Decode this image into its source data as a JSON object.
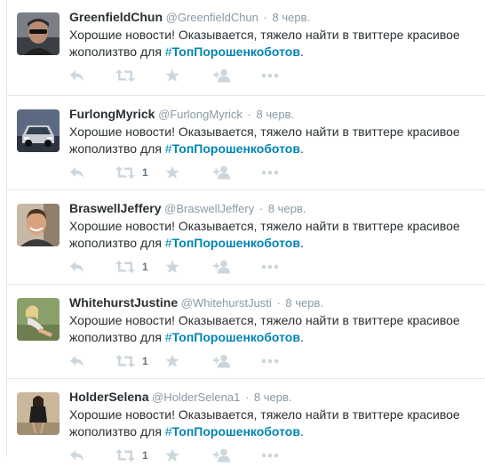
{
  "tweets": [
    {
      "fullname": "GreenfieldChun",
      "handle": "@GreenfieldChun",
      "separator": "·",
      "time": "8 черв.",
      "text_line1": "Хорошие новости! Оказывается, тяжело найти в твиттере красивое",
      "text_prefix": "жополизтво для ",
      "hash_symbol": "#",
      "hashtag": "ТопПорошенкоботов",
      "text_suffix": ".",
      "retweet_count": "",
      "avatar_icon": "man-with-sunglasses-avatar"
    },
    {
      "fullname": "FurlongMyrick",
      "handle": "@FurlongMyrick",
      "separator": "·",
      "time": "8 черв.",
      "text_line1": "Хорошие новости! Оказывается, тяжело найти в твиттере красивое",
      "text_prefix": "жополизтво для ",
      "hash_symbol": "#",
      "hashtag": "ТопПорошенкоботов",
      "text_suffix": ".",
      "retweet_count": "1",
      "avatar_icon": "car-avatar"
    },
    {
      "fullname": "BraswellJeffery",
      "handle": "@BraswellJeffery",
      "separator": "·",
      "time": "8 черв.",
      "text_line1": "Хорошие новости! Оказывается, тяжело найти в твиттере красивое",
      "text_prefix": "жополизтво для ",
      "hash_symbol": "#",
      "hashtag": "ТопПорошенкоботов",
      "text_suffix": ".",
      "retweet_count": "1",
      "avatar_icon": "smiling-man-avatar"
    },
    {
      "fullname": "WhitehurstJustine",
      "handle": "@WhitehurstJusti",
      "separator": "·",
      "time": "8 черв.",
      "text_line1": "Хорошие новости! Оказывается, тяжело найти в твиттере красивое",
      "text_prefix": "жополизтво для ",
      "hash_symbol": "#",
      "hashtag": "ТопПорошенкоботов",
      "text_suffix": ".",
      "retweet_count": "1",
      "avatar_icon": "woman-outdoors-avatar"
    },
    {
      "fullname": "HolderSelena",
      "handle": "@HolderSelena1",
      "separator": "·",
      "time": "8 черв.",
      "text_line1": "Хорошие новости! Оказывается, тяжело найти в твиттере красивое",
      "text_prefix": "жополизтво для ",
      "hash_symbol": "#",
      "hashtag": "ТопПорошенкоботов",
      "text_suffix": ".",
      "retweet_count": "1",
      "avatar_icon": "woman-full-length-avatar"
    }
  ],
  "action_icons": [
    "reply-icon",
    "retweet-icon",
    "favorite-icon",
    "follow-icon",
    "more-icon"
  ],
  "colors": {
    "hashtag": "#0084b4",
    "muted": "#8899a6",
    "text": "#292f33",
    "icon": "#ccd6dd",
    "divider": "#e1e8ed"
  }
}
